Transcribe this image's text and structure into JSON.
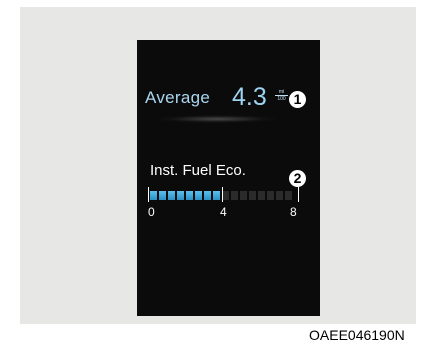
{
  "average": {
    "label": "Average",
    "value": "4.3",
    "unit_top": "mi",
    "unit_bottom": "100"
  },
  "instant": {
    "title": "Inst. Fuel Eco.",
    "scale_labels": [
      "0",
      "4",
      "8"
    ],
    "level_fraction": 0.5,
    "active_color": "#3aa8df"
  },
  "callouts": [
    "1",
    "2"
  ],
  "figure_code": "OAEE046190N"
}
